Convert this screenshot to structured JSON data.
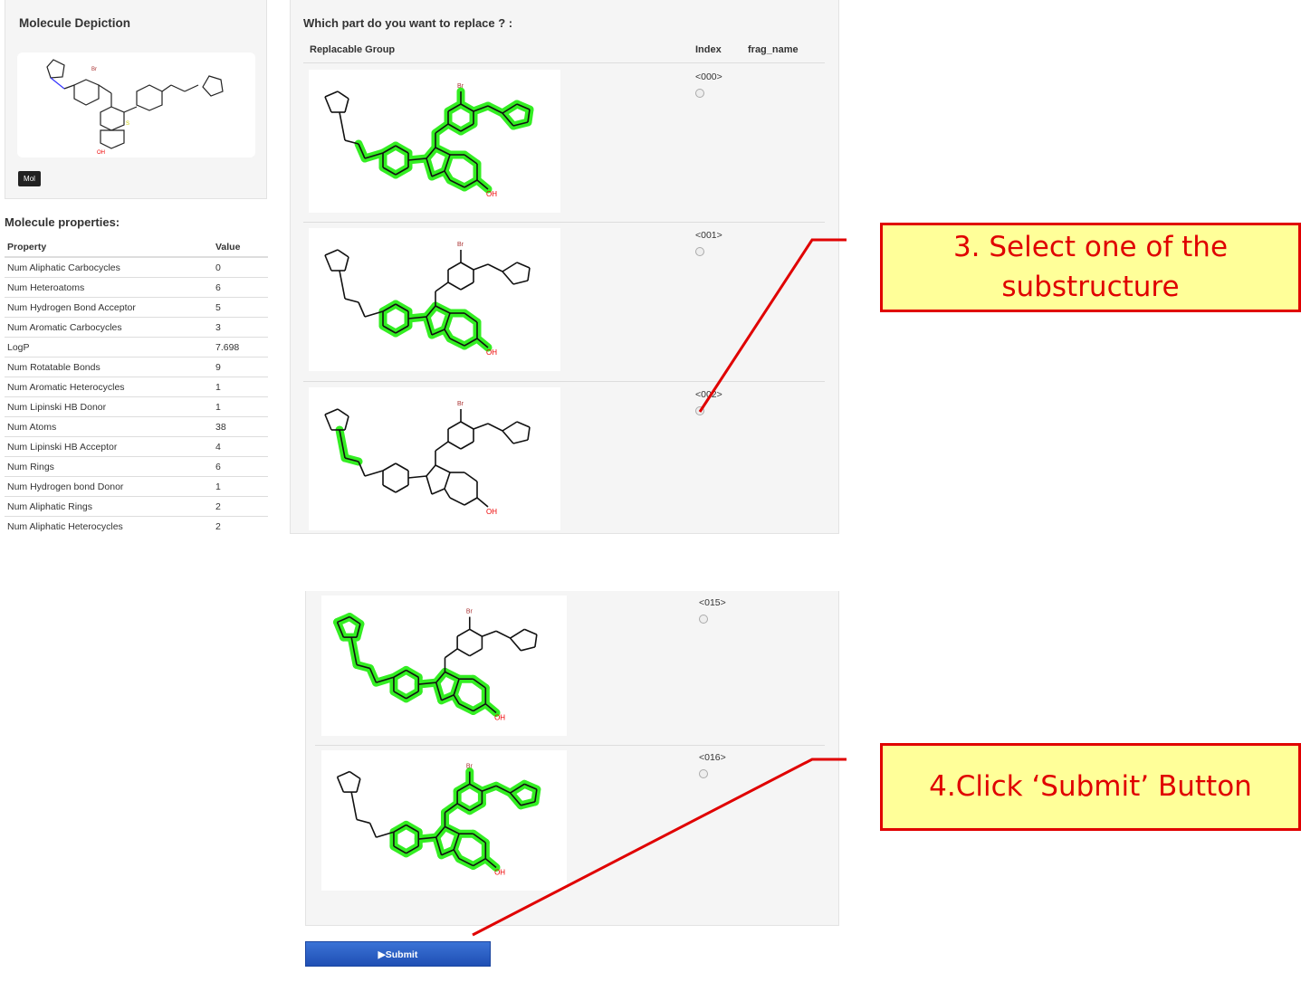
{
  "left_panel": {
    "title": "Molecule Depiction",
    "mol_button": "Mol",
    "oh_label": "OH",
    "s_label": "S",
    "br_label": "Br"
  },
  "properties": {
    "title": "Molecule properties:",
    "col_property": "Property",
    "col_value": "Value",
    "rows": [
      {
        "name": "Num Aliphatic Carbocycles",
        "value": "0"
      },
      {
        "name": "Num Heteroatoms",
        "value": "6"
      },
      {
        "name": "Num Hydrogen Bond Acceptor",
        "value": "5"
      },
      {
        "name": "Num Aromatic Carbocycles",
        "value": "3"
      },
      {
        "name": "LogP",
        "value": "7.698"
      },
      {
        "name": "Num Rotatable Bonds",
        "value": "9"
      },
      {
        "name": "Num Aromatic Heterocycles",
        "value": "1"
      },
      {
        "name": "Num Lipinski HB Donor",
        "value": "1"
      },
      {
        "name": "Num Atoms",
        "value": "38"
      },
      {
        "name": "Num Lipinski HB Acceptor",
        "value": "4"
      },
      {
        "name": "Num Rings",
        "value": "6"
      },
      {
        "name": "Num Hydrogen bond Donor",
        "value": "1"
      },
      {
        "name": "Num Aliphatic Rings",
        "value": "2"
      },
      {
        "name": "Num Aliphatic Heterocycles",
        "value": "2"
      }
    ]
  },
  "replace": {
    "question": "Which part do you want to replace ? :",
    "col_group": "Replacable Group",
    "col_index": "Index",
    "col_frag": "frag_name",
    "groups": [
      {
        "index": "<000>",
        "oh": "OH",
        "br": "Br"
      },
      {
        "index": "<001>",
        "oh": "OH",
        "br": "Br"
      },
      {
        "index": "<002>",
        "oh": "OH",
        "br": "Br"
      },
      {
        "index": "<015>",
        "oh": "OH",
        "br": "Br"
      },
      {
        "index": "<016>",
        "oh": "OH",
        "br": "Br"
      }
    ]
  },
  "submit_label": "▶Submit",
  "callouts": {
    "step3_line1": "3. Select one of the",
    "step3_line2": "substructure",
    "step4": "4.Click ‘Submit’ Button"
  },
  "colors": {
    "highlight": "#33ee22",
    "callout_bg": "#ffff99",
    "callout_border": "#e00000",
    "submit": "#2a5fc8"
  }
}
